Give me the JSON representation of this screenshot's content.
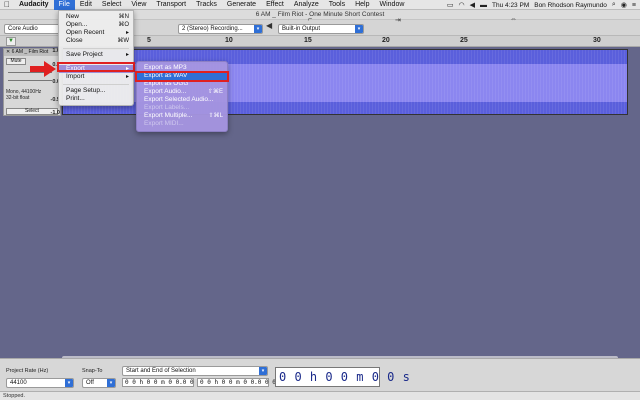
{
  "menubar": {
    "app": "Audacity",
    "items": [
      "File",
      "Edit",
      "Select",
      "View",
      "Transport",
      "Tracks",
      "Generate",
      "Effect",
      "Analyze",
      "Tools",
      "Help",
      "Window"
    ],
    "clock": "Thu 4:23 PM",
    "user": "Bon Rhodson Raymundo",
    "status_icons": [
      "screen-icon",
      "wifi-icon",
      "volume-icon",
      "battery-icon",
      "search-icon",
      "control-center-icon",
      "list-icon"
    ]
  },
  "window": {
    "title": "6 AM _ Film Riot - One Minute Short Contest"
  },
  "toolbar": {
    "host": "Core Audio",
    "channels": "2 (Stereo) Recording...",
    "output": "Built-in Output"
  },
  "ruler": {
    "ticks": [
      "5",
      "10",
      "15",
      "20",
      "25",
      "30"
    ]
  },
  "track": {
    "name": "6 AM _ Film Riot",
    "mute_label": "Mute",
    "info_line1": "Mono, 44100Hz",
    "info_line2": "32-bit float",
    "select_label": "Select",
    "scale": [
      "1.0",
      "0.5",
      "0.0",
      "-0.5",
      "-1.0"
    ]
  },
  "file_menu": {
    "items": [
      {
        "label": "New",
        "shortcut": "⌘N"
      },
      {
        "label": "Open...",
        "shortcut": "⌘O"
      },
      {
        "label": "Open Recent",
        "shortcut": "▸"
      },
      {
        "label": "Close",
        "shortcut": "⌘W"
      },
      {
        "label": "Save Project",
        "shortcut": "▸"
      },
      {
        "label": "Export",
        "shortcut": "▸"
      },
      {
        "label": "Import",
        "shortcut": "▸"
      },
      {
        "label": "Page Setup...",
        "shortcut": ""
      },
      {
        "label": "Print...",
        "shortcut": ""
      }
    ]
  },
  "export_menu": {
    "items": [
      {
        "label": "Export as MP3",
        "shortcut": ""
      },
      {
        "label": "Export as WAV",
        "shortcut": ""
      },
      {
        "label": "Export as OGG",
        "shortcut": ""
      },
      {
        "label": "Export Audio...",
        "shortcut": "⇧⌘E"
      },
      {
        "label": "Export Selected Audio...",
        "shortcut": ""
      },
      {
        "label": "Export Labels...",
        "shortcut": ""
      },
      {
        "label": "Export Multiple...",
        "shortcut": "⇧⌘L"
      },
      {
        "label": "Export MIDI...",
        "shortcut": ""
      }
    ]
  },
  "selection_bar": {
    "project_rate_label": "Project Rate (Hz)",
    "project_rate_value": "44100",
    "snap_label": "Snap-To",
    "snap_value": "Off",
    "selection_mode": "Start and End of Selection",
    "start_time": "0 0 h 0 0 m 0 0.0 0 0 s",
    "end_time": "0 0 h 0 0 m 0 0.0 0 0 s",
    "audio_position": "0 0 h 0 0 m 0 0 s"
  },
  "status": {
    "text": "Stopped."
  },
  "colors": {
    "highlight": "#2f6fd6",
    "waveform": "#5a5fdc",
    "annotation": "#e02020"
  }
}
